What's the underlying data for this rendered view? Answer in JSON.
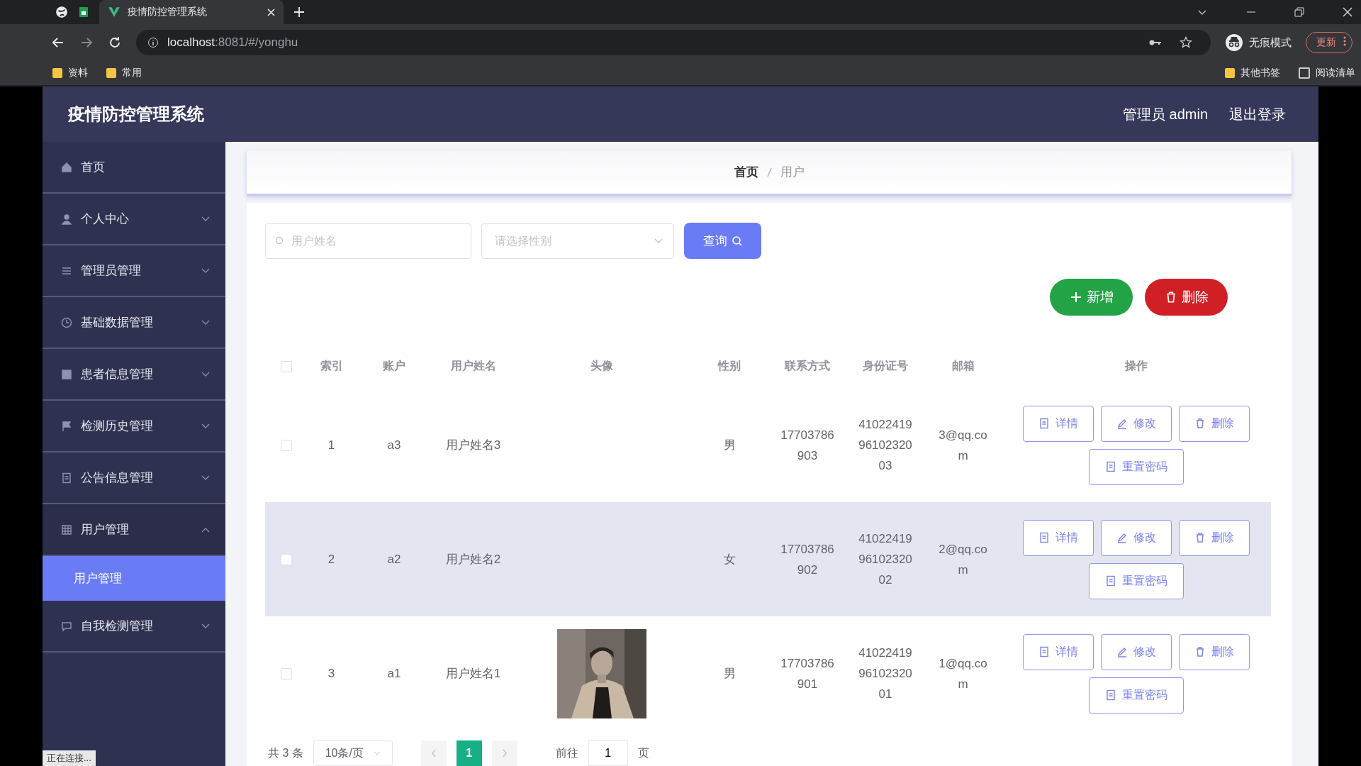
{
  "browser": {
    "tabs": [
      {
        "title": "疫情防控管理系统",
        "selected": true
      }
    ],
    "address_host": "localhost",
    "address_rest": ":8081/#/yonghu",
    "incognito": "无痕模式",
    "update": "更新",
    "bookmarks_left": [
      "资料",
      "常用"
    ],
    "bookmarks_right": [
      "其他书签",
      "阅读清单"
    ]
  },
  "app": {
    "title": "疫情防控管理系统",
    "user": "管理员 admin",
    "logout": "退出登录"
  },
  "sidebar": {
    "items": [
      {
        "label": "首页",
        "kind": "link"
      },
      {
        "label": "个人中心",
        "kind": "submenu",
        "expanded": false
      },
      {
        "label": "管理员管理",
        "kind": "submenu",
        "expanded": false
      },
      {
        "label": "基础数据管理",
        "kind": "submenu",
        "expanded": false
      },
      {
        "label": "患者信息管理",
        "kind": "submenu",
        "expanded": false
      },
      {
        "label": "检测历史管理",
        "kind": "submenu",
        "expanded": false
      },
      {
        "label": "公告信息管理",
        "kind": "submenu",
        "expanded": false
      },
      {
        "label": "用户管理",
        "kind": "submenu",
        "expanded": true,
        "children": [
          {
            "label": "用户管理",
            "selected": true
          }
        ]
      },
      {
        "label": "自我检测管理",
        "kind": "submenu",
        "expanded": false
      }
    ]
  },
  "breadcrumb": [
    "首页",
    "用户"
  ],
  "search": {
    "name_placeholder": "用户姓名",
    "gender_placeholder": "请选择性别",
    "query": "查询"
  },
  "actions": {
    "add": "新增",
    "delete": "删除"
  },
  "table": {
    "select_all_checked": false,
    "columns": [
      "索引",
      "账户",
      "用户姓名",
      "头像",
      "性别",
      "联系方式",
      "身份证号",
      "邮箱",
      "操作"
    ],
    "rows": [
      {
        "checked": false,
        "highlighted": false,
        "cells": [
          "1",
          "a3",
          "用户姓名3",
          "",
          "男",
          "17703786903",
          "410224199610232003",
          "3@qq.com"
        ],
        "avatar": {
          "kind": "none"
        },
        "buttons": [
          "详情",
          "修改",
          "删除",
          "重置密码"
        ]
      },
      {
        "checked": false,
        "highlighted": true,
        "cells": [
          "2",
          "a2",
          "用户姓名2",
          "",
          "女",
          "17703786902",
          "410224199610232002",
          "2@qq.com"
        ],
        "avatar": {
          "kind": "none"
        },
        "buttons": [
          "详情",
          "修改",
          "删除",
          "重置密码"
        ]
      },
      {
        "checked": false,
        "highlighted": false,
        "cells": [
          "3",
          "a1",
          "用户姓名1",
          "",
          "男",
          "17703786901",
          "410224199610232001",
          "1@qq.com"
        ],
        "avatar": {
          "kind": "picture"
        },
        "buttons": [
          "详情",
          "修改",
          "删除",
          "重置密码"
        ]
      }
    ]
  },
  "pagination": {
    "total": "共 3 条",
    "page_size": "10条/页",
    "pages": [
      {
        "label": "1",
        "selected": true
      }
    ],
    "goto": "前往",
    "goto_value": "1",
    "page_unit": "页"
  },
  "status_bar": "正在连接..."
}
